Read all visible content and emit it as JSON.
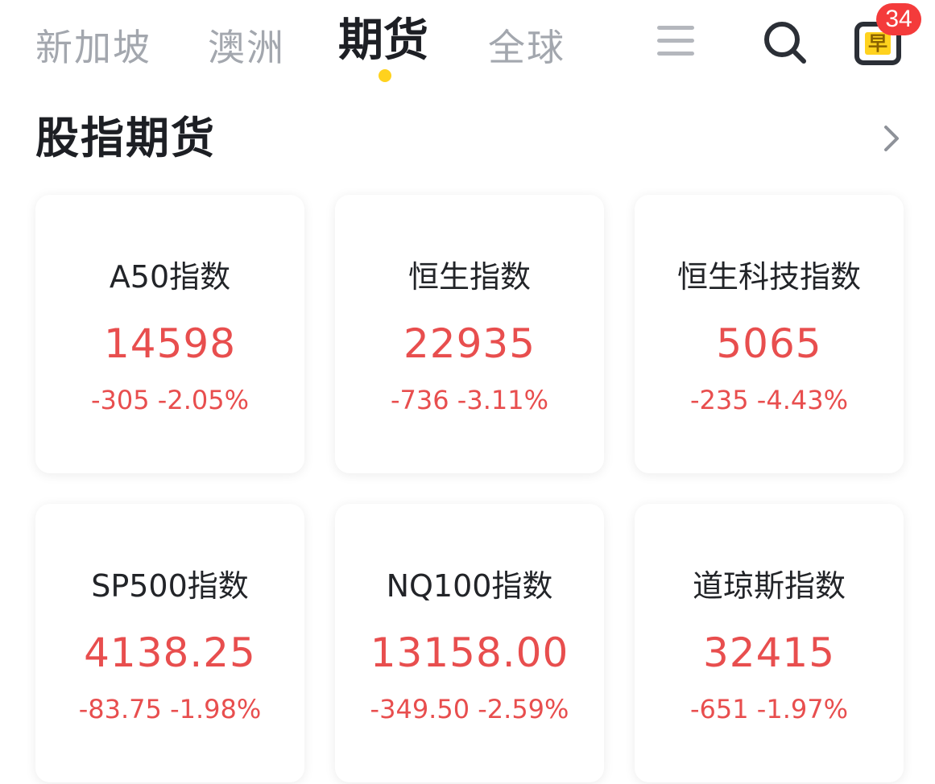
{
  "nav": {
    "tabs": [
      {
        "label": "新加坡"
      },
      {
        "label": "澳洲"
      },
      {
        "label": "期货"
      },
      {
        "label": "全球"
      }
    ],
    "active_tab": "期货",
    "notification_count": "34",
    "notification_icon_char": "早",
    "colors": {
      "active_dot": "#ffd21e",
      "badge": "#f43b3b"
    }
  },
  "icons": [
    "menu-icon",
    "search-icon",
    "morning-notice-icon",
    "chevron-right-icon"
  ],
  "section": {
    "title": "股指期货"
  },
  "cards": [
    {
      "name": "A50指数",
      "price": "14598",
      "change": "-305 -2.05%"
    },
    {
      "name": "恒生指数",
      "price": "22935",
      "change": "-736 -3.11%"
    },
    {
      "name": "恒生科技指数",
      "price": "5065",
      "change": "-235 -4.43%"
    },
    {
      "name": "SP500指数",
      "price": "4138.25",
      "change": "-83.75 -1.98%"
    },
    {
      "name": "NQ100指数",
      "price": "13158.00",
      "change": "-349.50 -2.59%"
    },
    {
      "name": "道琼斯指数",
      "price": "32415",
      "change": "-651 -1.97%"
    }
  ],
  "colors": {
    "down": "#e84e4e",
    "text_primary": "#1d1f24",
    "text_muted": "#a3a7ae"
  }
}
